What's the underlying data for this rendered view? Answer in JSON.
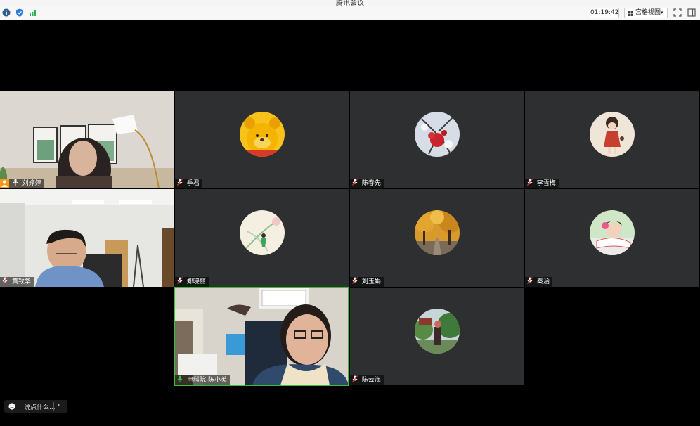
{
  "window": {
    "title": "腾讯会议"
  },
  "toolbar": {
    "info_icon": "info-icon",
    "shield_icon": "shield-icon",
    "signal_icon": "signal-icon",
    "timer": "01:19:42",
    "view_label": "宫格视图",
    "view_arrow": "▾"
  },
  "participants": [
    {
      "name": "刘婷婷",
      "type": "video",
      "host": true,
      "mic": "on"
    },
    {
      "name": "季君",
      "type": "avatar",
      "mic": "muted",
      "avatar": "winnie-the-pooh"
    },
    {
      "name": "陈春先",
      "type": "avatar",
      "mic": "muted",
      "avatar": "red-berries-snow"
    },
    {
      "name": "李雪梅",
      "type": "avatar",
      "mic": "muted",
      "avatar": "cartoon-girl"
    },
    {
      "name": "黄致华",
      "type": "video",
      "mic": "muted"
    },
    {
      "name": "郑晓丽",
      "type": "avatar",
      "mic": "muted",
      "avatar": "green-sketch"
    },
    {
      "name": "刘玉娟",
      "type": "avatar",
      "mic": "muted",
      "avatar": "autumn-trees"
    },
    {
      "name": "秦涵",
      "type": "avatar",
      "mic": "muted",
      "avatar": "child-photo"
    },
    {
      "name": "电科院-陈小英",
      "type": "video",
      "mic": "speaking"
    },
    {
      "name": "陈云海",
      "type": "avatar",
      "mic": "muted",
      "avatar": "person-garden"
    }
  ],
  "chat": {
    "placeholder": "说点什么...",
    "chevron": "‹"
  },
  "colors": {
    "accent_green": "#3bbf3b",
    "host_orange": "#f39a1e",
    "tile_bg": "#2d2f30"
  }
}
